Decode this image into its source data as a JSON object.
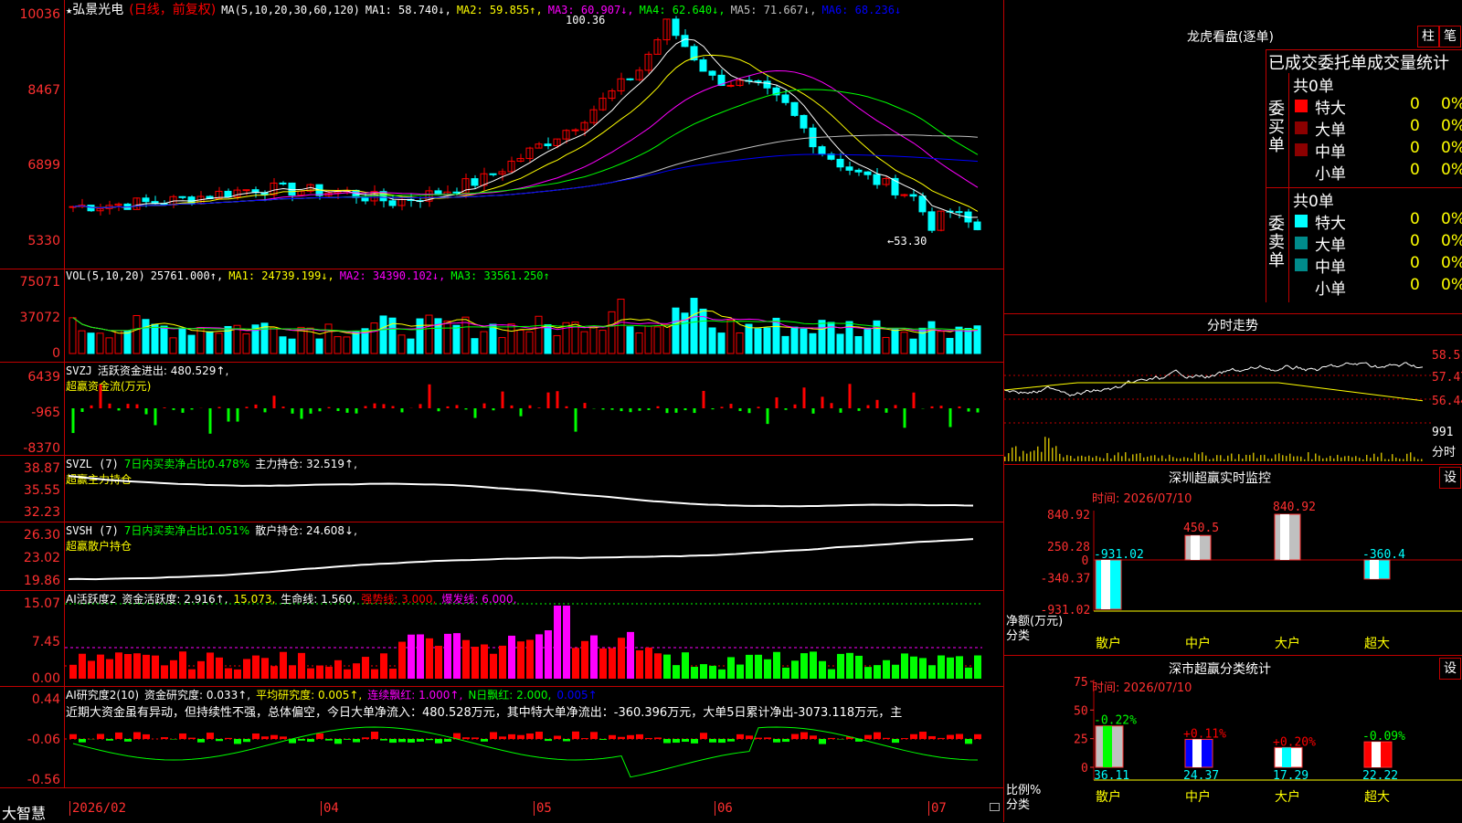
{
  "kline": {
    "star": "★",
    "name": "弘景光电",
    "mode": "(日线，前复权)",
    "ma_label": "MA(5,10,20,30,60,120)",
    "ma": [
      {
        "name": "MA1:",
        "value": "58.740↓,",
        "color": "#ffffff"
      },
      {
        "name": "MA2:",
        "value": "59.855↑,",
        "color": "#ffff00"
      },
      {
        "name": "MA3:",
        "value": "60.907↓,",
        "color": "#ff00ff"
      },
      {
        "name": "MA4:",
        "value": "62.640↓,",
        "color": "#00ff00"
      },
      {
        "name": "MA5:",
        "value": "71.667↓,",
        "color": "#c0c0c0"
      },
      {
        "name": "MA6:",
        "value": "68.236↓",
        "color": "#0000ff"
      }
    ],
    "y_labels": [
      "10036",
      "8467",
      "6899",
      "5330"
    ],
    "high_label": "100.36",
    "low_label": "←53.30"
  },
  "vol": {
    "label": "VOL(5,10,20)",
    "value": "25761.000↑,",
    "ma": [
      {
        "name": "MA1:",
        "value": "24739.199↓,",
        "color": "#ffff00"
      },
      {
        "name": "MA2:",
        "value": "34390.102↓,",
        "color": "#ff00ff"
      },
      {
        "name": "MA3:",
        "value": "33561.250↑",
        "color": "#00ff00"
      }
    ],
    "y_labels": [
      "75071",
      "37072",
      "0"
    ]
  },
  "svzj": {
    "label": "SVZJ",
    "line1": "活跃资金进出: 480.529↑,",
    "line2": "超赢资金流(万元)",
    "y_labels": [
      "6439",
      "-965",
      "-8370"
    ]
  },
  "svzl": {
    "label": "SVZL (7)",
    "desc": "7日内买卖净占比0.478%",
    "value": "主力持仓: 32.519↑,",
    "line2": "超赢主力持仓",
    "y_labels": [
      "38.87",
      "35.55",
      "32.23"
    ]
  },
  "svsh": {
    "label": "SVSH (7)",
    "desc": "7日内买卖净占比1.051%",
    "value": "散户持仓: 24.608↓,",
    "line2": "超赢散户持仓",
    "y_labels": [
      "26.30",
      "23.02",
      "19.86"
    ]
  },
  "ai1": {
    "label": "AI活跃度2",
    "a": "资金活跃度: 2.916↑,",
    "b": "15.073,",
    "c": "生命线: 1.560,",
    "d": "强势线: 3.000,",
    "e": "爆发线: 6.000,",
    "y_labels": [
      "15.07",
      "7.45",
      "0.00"
    ]
  },
  "ai2": {
    "label": "AI研究度2(10)",
    "a": "资金研究度: 0.033↑,",
    "b": "平均研究度: 0.005↑,",
    "c": "连续飘红: 1.000↑,",
    "d": "N日飘红: 2.000,",
    "e": "0.005↑",
    "text": "近期大资金虽有异动，但持续性不强，总体偏空，今日大单净流入：480.528万元，其中特大单净流出：-360.396万元，大单5日累计净出-3073.118万元，主",
    "y_labels": [
      "0.44",
      "-0.06",
      "-0.56"
    ]
  },
  "xaxis": {
    "brand": "大智慧",
    "labels": [
      "2026/02",
      "04",
      "05",
      "06",
      "07"
    ]
  },
  "longhu": {
    "title": "龙虎看盘(逐单)",
    "btn1": "柱",
    "btn2": "笔",
    "sub": "已成交委托单成交量统计",
    "buy_label": "委买单",
    "sell_label": "委卖单",
    "total": "共0单",
    "rows": [
      {
        "name": "特大",
        "v": "0",
        "p": "0%"
      },
      {
        "name": "大单",
        "v": "0",
        "p": "0%"
      },
      {
        "name": "中单",
        "v": "0",
        "p": "0%"
      },
      {
        "name": "小单",
        "v": "0",
        "p": "0%"
      }
    ]
  },
  "fenshi": {
    "title": "分时走势",
    "labels": [
      "58.51",
      "57.47",
      "56.44",
      "991",
      "分时"
    ]
  },
  "monitor": {
    "title": "深圳超赢实时监控",
    "btn": "设",
    "time": "时间: 2026/07/10",
    "y_labels": [
      "840.92",
      "250.28",
      "0",
      "-340.37",
      "-931.02"
    ],
    "ylabel1": "净额(万元)",
    "ylabel2": "分类",
    "cats": [
      "散户",
      "中户",
      "大户",
      "超大"
    ],
    "values": [
      -931.02,
      450.5,
      840.92,
      -360.4
    ],
    "value_labels": [
      "-931.02",
      "450.5",
      "840.92",
      "-360.4"
    ]
  },
  "classify": {
    "title": "深市超赢分类统计",
    "btn": "设",
    "time": "时间: 2026/07/10",
    "y_labels": [
      "75",
      "50",
      "25",
      "0"
    ],
    "ylabel1": "比例%",
    "ylabel2": "分类",
    "cats": [
      "散户",
      "中户",
      "大户",
      "超大"
    ],
    "values": [
      36.11,
      24.37,
      17.29,
      22.22
    ],
    "value_labels": [
      "36.11",
      "24.37",
      "17.29",
      "22.22"
    ],
    "changes": [
      "-0.22%",
      "+0.11%",
      "+0.20%",
      "-0.09%"
    ]
  },
  "colors": {
    "up": "#ff0000",
    "down": "#00ffff",
    "grid": "#c00000",
    "green": "#00ff00",
    "magenta": "#ff00ff"
  }
}
